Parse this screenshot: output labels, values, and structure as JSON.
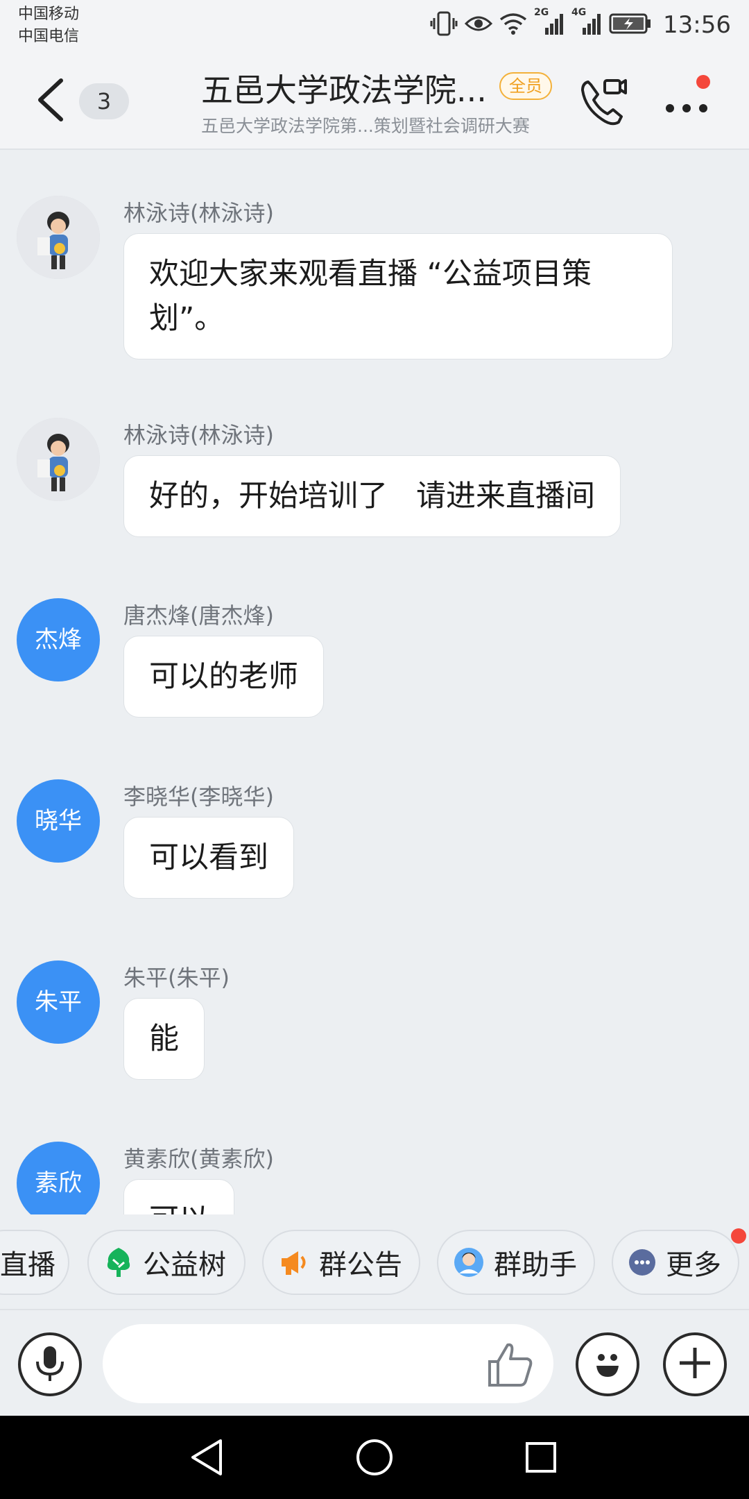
{
  "status_bar": {
    "carrier1": "中国移动",
    "carrier2": "中国电信",
    "network_a": "2G",
    "network_b": "4G",
    "time": "13:56"
  },
  "header": {
    "unread_count": "3",
    "title": "五邑大学政法学院...",
    "tag": "全员",
    "subtitle": "五邑大学政法学院第...策划暨社会调研大赛"
  },
  "messages": [
    {
      "sender": "林泳诗(林泳诗)",
      "avatar_type": "photo",
      "text": "欢迎大家来观看直播 “公益项目策划”。"
    },
    {
      "sender": "林泳诗(林泳诗)",
      "avatar_type": "photo",
      "text": "好的，开始培训了   请进来直播间"
    },
    {
      "sender": "唐杰烽(唐杰烽)",
      "avatar_type": "initials",
      "avatar_text": "杰烽",
      "text": "可以的老师"
    },
    {
      "sender": "李晓华(李晓华)",
      "avatar_type": "initials",
      "avatar_text": "晓华",
      "text": "可以看到"
    },
    {
      "sender": "朱平(朱平)",
      "avatar_type": "initials",
      "avatar_text": "朱平",
      "text": "能"
    },
    {
      "sender": "黄素欣(黄素欣)",
      "avatar_type": "initials",
      "avatar_text": "素欣",
      "text": "可以"
    }
  ],
  "quick_actions": [
    {
      "label": "直播",
      "icon": "live-icon"
    },
    {
      "label": "公益树",
      "icon": "tree-icon"
    },
    {
      "label": "群公告",
      "icon": "megaphone-icon"
    },
    {
      "label": "群助手",
      "icon": "assistant-icon"
    },
    {
      "label": "更多",
      "icon": "more-dots-icon"
    }
  ],
  "colors": {
    "accent_blue": "#3b91f5",
    "badge_red": "#f4473b",
    "tag_orange": "#f0a020",
    "tree_green": "#16b35a"
  }
}
